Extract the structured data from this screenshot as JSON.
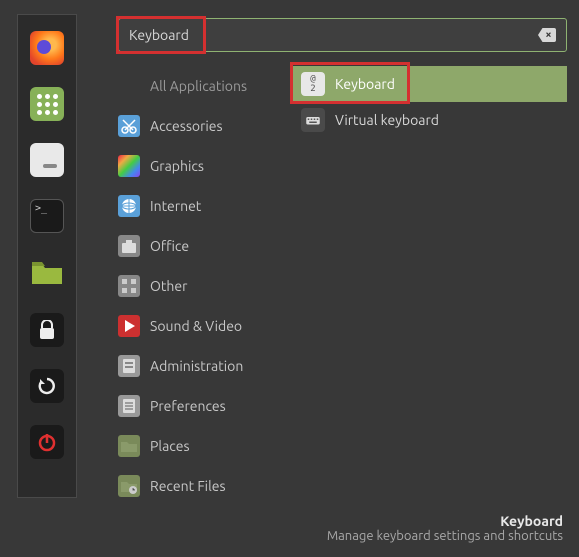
{
  "search": {
    "value": "Keyboard"
  },
  "sidebar": [
    {
      "name": "firefox-icon"
    },
    {
      "name": "apps-icon"
    },
    {
      "name": "files-icon"
    },
    {
      "name": "terminal-icon"
    },
    {
      "name": "folder-icon"
    },
    {
      "name": "lock-icon"
    },
    {
      "name": "refresh-icon"
    },
    {
      "name": "power-icon"
    }
  ],
  "categories": [
    {
      "label": "All Applications",
      "icon": "none"
    },
    {
      "label": "Accessories",
      "icon": "scissors"
    },
    {
      "label": "Graphics",
      "icon": "graphics"
    },
    {
      "label": "Internet",
      "icon": "globe"
    },
    {
      "label": "Office",
      "icon": "briefcase"
    },
    {
      "label": "Other",
      "icon": "grid"
    },
    {
      "label": "Sound & Video",
      "icon": "play"
    },
    {
      "label": "Administration",
      "icon": "admin"
    },
    {
      "label": "Preferences",
      "icon": "prefs"
    },
    {
      "label": "Places",
      "icon": "folder"
    },
    {
      "label": "Recent Files",
      "icon": "folder"
    }
  ],
  "results": [
    {
      "label": "Keyboard",
      "selected": true
    },
    {
      "label": "Virtual keyboard",
      "selected": false
    }
  ],
  "footer": {
    "title": "Keyboard",
    "subtitle": "Manage keyboard settings and shortcuts"
  }
}
